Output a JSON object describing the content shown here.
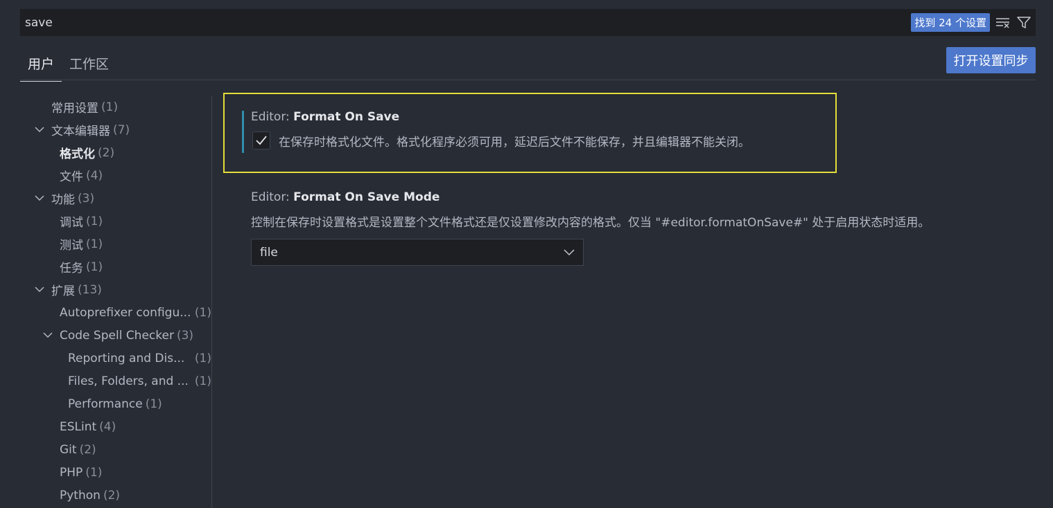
{
  "search": {
    "value": "save",
    "result_badge": "找到 24 个设置",
    "clear_icon": "clear-filter-icon",
    "filter_icon": "filter-icon"
  },
  "tabs": [
    {
      "label": "用户",
      "active": true
    },
    {
      "label": "工作区",
      "active": false
    }
  ],
  "sync_button": "打开设置同步",
  "toc": [
    {
      "label": "常用设置",
      "count": "(1)",
      "level": 0,
      "chevron": false
    },
    {
      "label": "文本编辑器",
      "count": "(7)",
      "level": 0,
      "chevron": true
    },
    {
      "label": "格式化",
      "count": "(2)",
      "level": 1,
      "chevron": false,
      "bold": true
    },
    {
      "label": "文件",
      "count": "(4)",
      "level": 1,
      "chevron": false
    },
    {
      "label": "功能",
      "count": "(3)",
      "level": 0,
      "chevron": true
    },
    {
      "label": "调试",
      "count": "(1)",
      "level": 1,
      "chevron": false
    },
    {
      "label": "测试",
      "count": "(1)",
      "level": 1,
      "chevron": false
    },
    {
      "label": "任务",
      "count": "(1)",
      "level": 1,
      "chevron": false
    },
    {
      "label": "扩展",
      "count": "(13)",
      "level": 0,
      "chevron": true
    },
    {
      "label": "Autoprefixer configu...",
      "count": "(1)",
      "level": 1,
      "chevron": false,
      "count_right": true
    },
    {
      "label": "Code Spell Checker",
      "count": "(3)",
      "level": 1,
      "chevron": true
    },
    {
      "label": "Reporting and Dis...",
      "count": "(1)",
      "level": 2,
      "chevron": false,
      "count_right": true
    },
    {
      "label": "Files, Folders, and ...",
      "count": "(1)",
      "level": 2,
      "chevron": false,
      "count_right": true
    },
    {
      "label": "Performance",
      "count": "(1)",
      "level": 2,
      "chevron": false
    },
    {
      "label": "ESLint",
      "count": "(4)",
      "level": 1,
      "chevron": false
    },
    {
      "label": "Git",
      "count": "(2)",
      "level": 1,
      "chevron": false
    },
    {
      "label": "PHP",
      "count": "(1)",
      "level": 1,
      "chevron": false
    },
    {
      "label": "Python",
      "count": "(2)",
      "level": 1,
      "chevron": false
    }
  ],
  "settings": {
    "format_on_save": {
      "category": "Editor: ",
      "name": "Format On Save",
      "description": "在保存时格式化文件。格式化程序必须可用，延迟后文件不能保存，并且编辑器不能关闭。",
      "checked": true
    },
    "format_on_save_mode": {
      "category": "Editor: ",
      "name": "Format On Save Mode",
      "description": "控制在保存时设置格式是设置整个文件格式还是仅设置修改内容的格式。仅当 \"#editor.formatOnSave#\" 处于启用状态时适用。",
      "value": "file"
    }
  },
  "colors": {
    "accent": "#4d78cc",
    "focus_border": "#e5de3a",
    "modified_bar": "#2e8fad"
  }
}
